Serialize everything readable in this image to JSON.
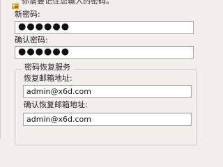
{
  "info": {
    "message": "你需要记住您输入的密码。",
    "icon": "key-icon"
  },
  "fields": {
    "new_password": {
      "label": "新密码:",
      "value": "●●●●●●"
    },
    "confirm_password": {
      "label": "确认密码:",
      "value": "●●●●●●"
    }
  },
  "recovery": {
    "title": "密码恢复服务",
    "email": {
      "label": "恢复邮箱地址:",
      "value": "admin@x6d.com"
    },
    "confirm_email": {
      "label": "确认恢复邮箱地址:",
      "value": "admin@x6d.com"
    }
  }
}
